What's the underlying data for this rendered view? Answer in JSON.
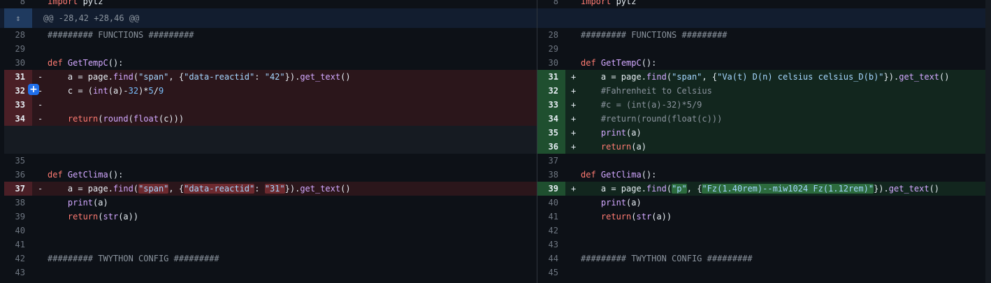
{
  "hunk": {
    "header": "@@ -28,42 +28,46 @@",
    "expand_icon": "unfold-icon"
  },
  "comment_button": {
    "label": "+"
  },
  "left": {
    "top": {
      "ln": "8",
      "code": "import pytz"
    },
    "lines": [
      {
        "ln": "28",
        "code": "######### FUNCTIONS #########"
      },
      {
        "ln": "29",
        "code": ""
      },
      {
        "ln": "30",
        "def": "def",
        "name": "GetTempC",
        "rest": "():"
      },
      {
        "ln": "31",
        "mark": "-",
        "a": "    a = page.",
        "f": "find",
        "b": "(",
        "s1": "\"span\"",
        "c": ", {",
        "s2": "\"data-reactid\"",
        "d": ": ",
        "s3": "\"42\"",
        "e": "}).",
        "g": "get_text",
        "h": "()"
      },
      {
        "ln": "32",
        "mark": "-",
        "code": "    c = (int(a)-32)*5/9"
      },
      {
        "ln": "33",
        "mark": "-",
        "code": ""
      },
      {
        "ln": "34",
        "mark": "-",
        "code": "    return(round(float(c)))"
      },
      {
        "ln": "35",
        "code": ""
      },
      {
        "ln": "36",
        "def": "def",
        "name": "GetClima",
        "rest": "():"
      },
      {
        "ln": "37",
        "mark": "-",
        "a": "    a = page.",
        "f": "find",
        "b": "(",
        "s1": "\"span\"",
        "c": ", {",
        "s2": "\"data-reactid\"",
        "d": ": ",
        "s3": "\"31\"",
        "e": "}).",
        "g": "get_text",
        "h": "()"
      },
      {
        "ln": "38",
        "code": "    print(a)"
      },
      {
        "ln": "39",
        "code": "    return(str(a))"
      },
      {
        "ln": "40",
        "code": ""
      },
      {
        "ln": "41",
        "code": ""
      },
      {
        "ln": "42",
        "code": "######### TWYTHON CONFIG #########"
      },
      {
        "ln": "43",
        "code": ""
      }
    ]
  },
  "right": {
    "top": {
      "ln": "8",
      "code": "import pytz"
    },
    "lines": [
      {
        "ln": "28",
        "code": "######### FUNCTIONS #########"
      },
      {
        "ln": "29",
        "code": ""
      },
      {
        "ln": "30",
        "def": "def",
        "name": "GetTempC",
        "rest": "():"
      },
      {
        "ln": "31",
        "mark": "+",
        "a": "    a = page.",
        "f": "find",
        "b": "(",
        "s1": "\"span\"",
        "c": ", {",
        "s2": "\"Va(t) D(n) celsius celsius_D(b)\"",
        "e": "}).",
        "g": "get_text",
        "h": "()"
      },
      {
        "ln": "32",
        "mark": "+",
        "code": "    #Fahrenheit to Celsius"
      },
      {
        "ln": "33",
        "mark": "+",
        "code": "    #c = (int(a)-32)*5/9"
      },
      {
        "ln": "34",
        "mark": "+",
        "code": "    #return(round(float(c)))"
      },
      {
        "ln": "35",
        "mark": "+",
        "code": "    print(a)"
      },
      {
        "ln": "36",
        "mark": "+",
        "code": "    return(a)"
      },
      {
        "ln": "37",
        "code": ""
      },
      {
        "ln": "38",
        "def": "def",
        "name": "GetClima",
        "rest": "():"
      },
      {
        "ln": "39",
        "mark": "+",
        "a": "    a = page.",
        "f": "find",
        "b": "(",
        "s1": "\"p\"",
        "c": ", {",
        "s2": "\"Fz(1.40rem)--miw1024 Fz(1.12rem)\"",
        "e": "}).",
        "g": "get_text",
        "h": "()"
      },
      {
        "ln": "40",
        "code": "    print(a)"
      },
      {
        "ln": "41",
        "code": "    return(str(a))"
      },
      {
        "ln": "42",
        "code": ""
      },
      {
        "ln": "43",
        "code": ""
      },
      {
        "ln": "44",
        "code": "######### TWYTHON CONFIG #########"
      },
      {
        "ln": "45",
        "code": ""
      }
    ]
  },
  "colors": {
    "background": "#0d1117",
    "deleted_line": "#2b161b",
    "added_line": "#12261e",
    "hunk_header": "#121d2f",
    "accent": "#1f6feb"
  }
}
